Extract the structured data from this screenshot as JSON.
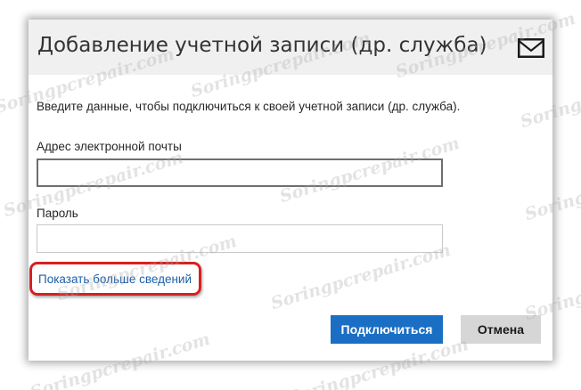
{
  "dialog": {
    "title": "Добавление учетной записи (др. служба)",
    "header_icon": "mail-icon",
    "instruction": "Введите данные, чтобы подключиться к своей учетной записи (др. служба).",
    "email": {
      "label": "Адрес электронной почты",
      "value": ""
    },
    "password": {
      "label": "Пароль",
      "value": ""
    },
    "more_link": "Показать больше сведений",
    "connect_button": "Подключиться",
    "cancel_button": "Отмена"
  },
  "watermark": {
    "text": "Soringpcrepair.com"
  },
  "colors": {
    "primary_button": "#1a6fc4",
    "link": "#1c5fa8",
    "highlight_border": "#d72020",
    "header_bg": "#f0f0f0"
  }
}
